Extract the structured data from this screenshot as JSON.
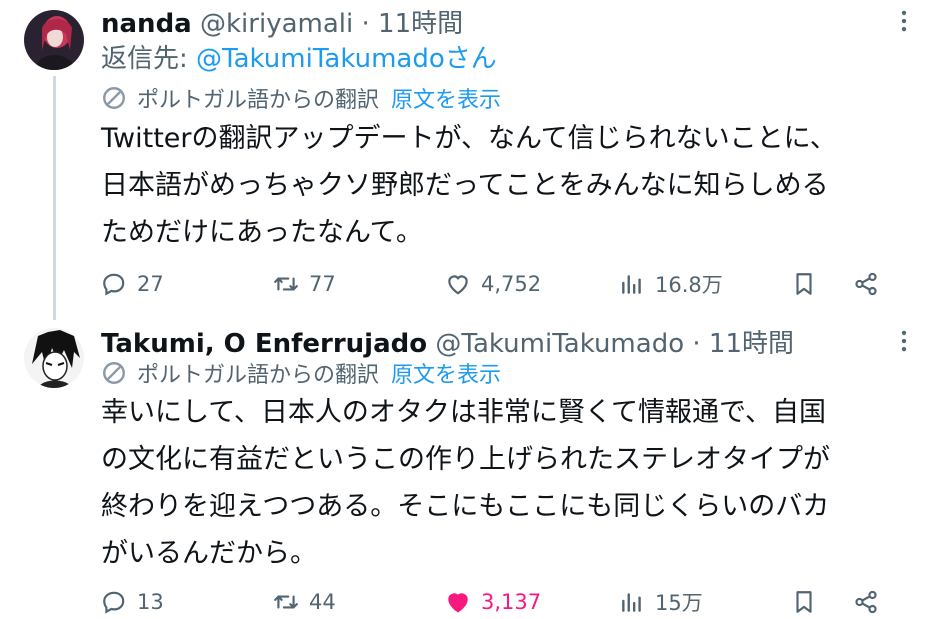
{
  "tweets": [
    {
      "display_name": "nanda",
      "handle": "@kiriyamali",
      "separator": "·",
      "time": "11時間",
      "reply_prefix": "返信先: ",
      "reply_handle": "@TakumiTakumadoさん",
      "translation_note": "ポルトガル語からの翻訳",
      "show_original": "原文を表示",
      "body_lines": [
        "Twitterの翻訳アップデートが、なんて信じられないことに、",
        "日本語がめっちゃクソ野郎だってことをみんなに知らしめる",
        "ためだけにあったなんて。"
      ],
      "replies": "27",
      "retweets": "77",
      "likes": "4,752",
      "views": "16.8万",
      "liked": false
    },
    {
      "display_name": "Takumi, O Enferrujado",
      "handle": "@TakumiTakumado",
      "separator": "·",
      "time": "11時間",
      "translation_note": "ポルトガル語からの翻訳",
      "show_original": "原文を表示",
      "body_lines": [
        "幸いにして、日本人のオタクは非常に賢くて情報通で、自国",
        "の文化に有益だというこの作り上げられたステレオタイプが",
        "終わりを迎えつつある。そこにもここにも同じくらいのバカ",
        "がいるんだから。"
      ],
      "replies": "13",
      "retweets": "44",
      "likes": "3,137",
      "views": "15万",
      "liked": true
    }
  ],
  "colors": {
    "accent": "#1d9bf0",
    "muted": "#536471",
    "like": "#f91880",
    "text": "#0f1419"
  },
  "icons": [
    "more-icon",
    "translate-icon",
    "reply-icon",
    "retweet-icon",
    "like-icon",
    "views-icon",
    "bookmark-icon",
    "share-icon"
  ]
}
